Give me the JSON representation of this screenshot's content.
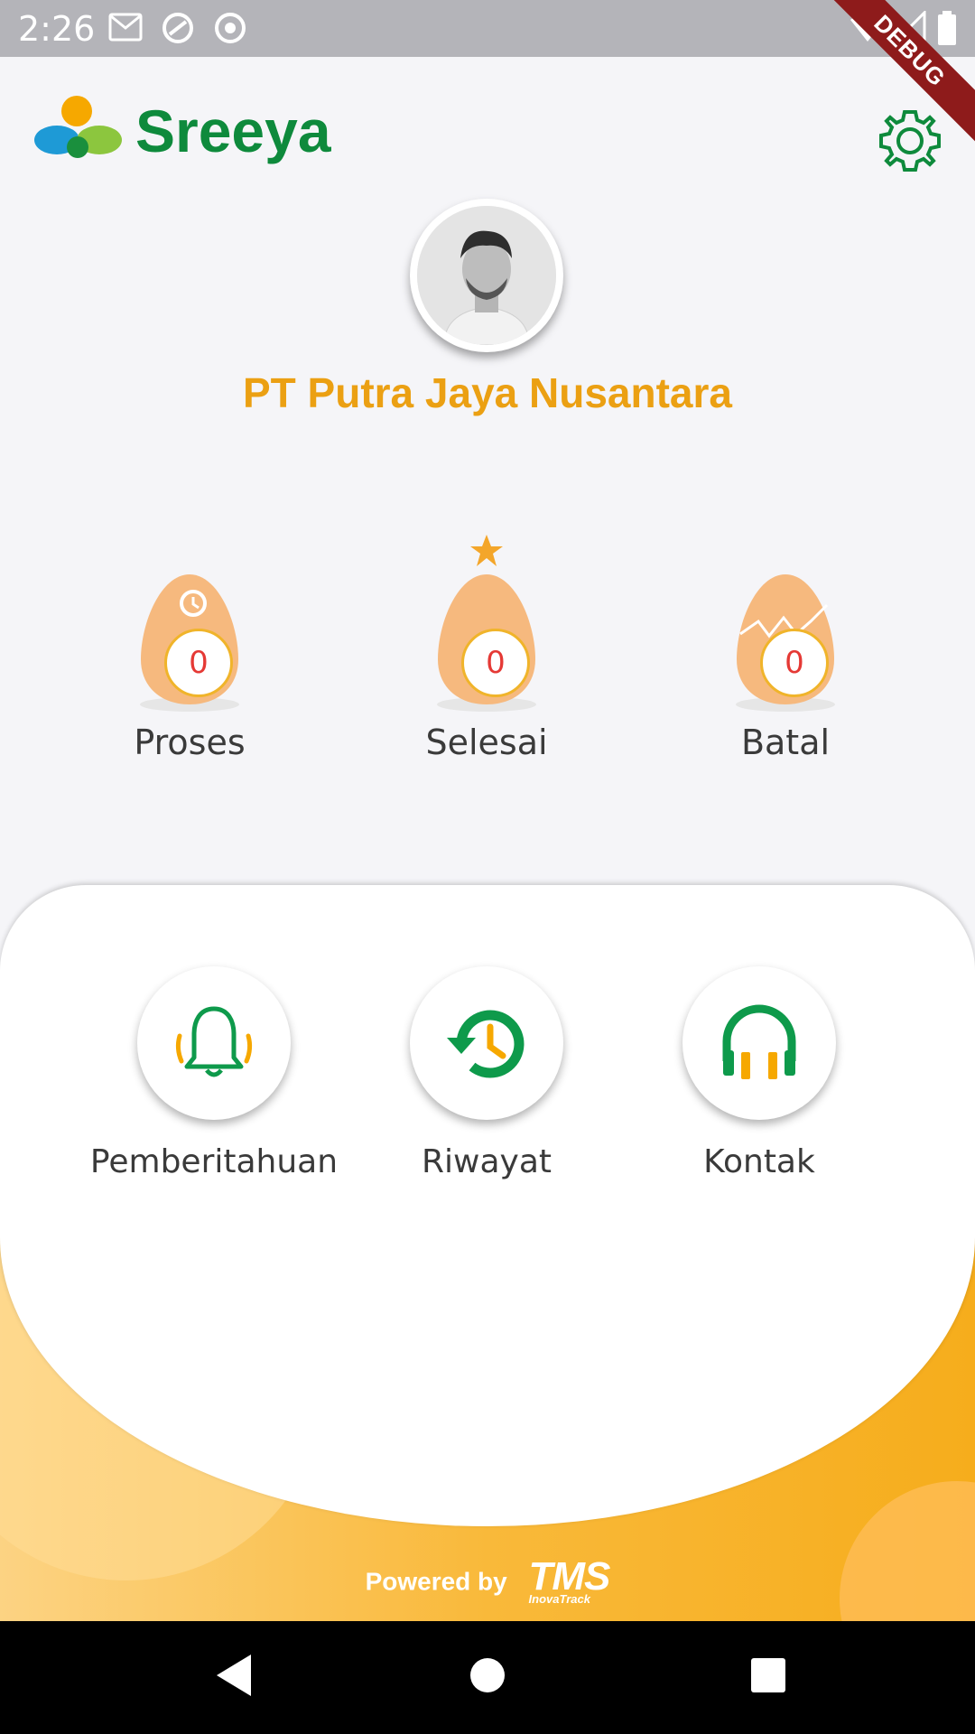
{
  "status_bar": {
    "time": "2:26",
    "debug": "DEBUG"
  },
  "app": {
    "name": "Sreeya"
  },
  "profile": {
    "company": "PT Putra Jaya Nusantara"
  },
  "stats": [
    {
      "label": "Proses",
      "count": "0"
    },
    {
      "label": "Selesai",
      "count": "0"
    },
    {
      "label": "Batal",
      "count": "0"
    }
  ],
  "menu": [
    {
      "label": "Pemberitahuan",
      "icon": "bell-icon"
    },
    {
      "label": "Riwayat",
      "icon": "history-icon"
    },
    {
      "label": "Kontak",
      "icon": "headset-icon"
    }
  ],
  "footer": {
    "powered_by": "Powered by",
    "brand": "TMS",
    "brand_sub": "InovaTrack"
  },
  "colors": {
    "brand_green": "#0e8a3c",
    "accent_orange": "#eba013",
    "count_red": "#e53935",
    "egg": "#f6b97e"
  }
}
